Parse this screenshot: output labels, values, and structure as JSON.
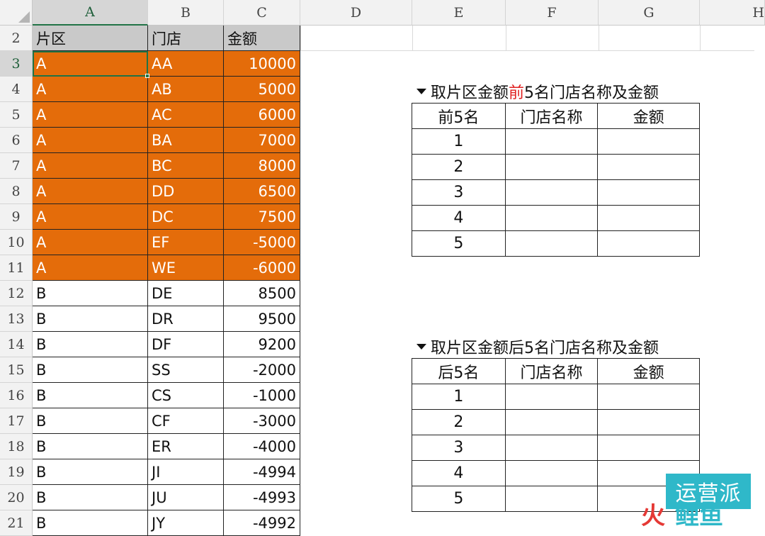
{
  "columns": [
    "A",
    "B",
    "C",
    "D",
    "E",
    "F",
    "G",
    "H"
  ],
  "rows": [
    {
      "num": "2",
      "a": "片区",
      "b": "门店",
      "c": "金额",
      "style": "header"
    },
    {
      "num": "3",
      "a": "A",
      "b": "AA",
      "c": "10000",
      "style": "orange"
    },
    {
      "num": "4",
      "a": "A",
      "b": "AB",
      "c": "5000",
      "style": "orange"
    },
    {
      "num": "5",
      "a": "A",
      "b": "AC",
      "c": "6000",
      "style": "orange"
    },
    {
      "num": "6",
      "a": "A",
      "b": "BA",
      "c": "7000",
      "style": "orange"
    },
    {
      "num": "7",
      "a": "A",
      "b": "BC",
      "c": "8000",
      "style": "orange"
    },
    {
      "num": "8",
      "a": "A",
      "b": "DD",
      "c": "6500",
      "style": "orange"
    },
    {
      "num": "9",
      "a": "A",
      "b": "DC",
      "c": "7500",
      "style": "orange"
    },
    {
      "num": "10",
      "a": "A",
      "b": "EF",
      "c": "-5000",
      "style": "orange"
    },
    {
      "num": "11",
      "a": "A",
      "b": "WE",
      "c": "-6000",
      "style": "orange"
    },
    {
      "num": "12",
      "a": "B",
      "b": "DE",
      "c": "8500",
      "style": "plain"
    },
    {
      "num": "13",
      "a": "B",
      "b": "DR",
      "c": "9500",
      "style": "plain"
    },
    {
      "num": "14",
      "a": "B",
      "b": "DF",
      "c": "9200",
      "style": "plain"
    },
    {
      "num": "15",
      "a": "B",
      "b": "SS",
      "c": "-2000",
      "style": "plain"
    },
    {
      "num": "16",
      "a": "B",
      "b": "CS",
      "c": "-1000",
      "style": "plain"
    },
    {
      "num": "17",
      "a": "B",
      "b": "CF",
      "c": "-3000",
      "style": "plain"
    },
    {
      "num": "18",
      "a": "B",
      "b": "ER",
      "c": "-4000",
      "style": "plain"
    },
    {
      "num": "19",
      "a": "B",
      "b": "JI",
      "c": "-4994",
      "style": "plain"
    },
    {
      "num": "20",
      "a": "B",
      "b": "JU",
      "c": "-4993",
      "style": "plain"
    },
    {
      "num": "21",
      "a": "B",
      "b": "JY",
      "c": "-4992",
      "style": "plain"
    }
  ],
  "top_table": {
    "caption_pre": "取片区金额",
    "caption_red": "前",
    "caption_post": "5名门店名称及金额",
    "headers": [
      "前5名",
      "门店名称",
      "金额"
    ],
    "ranks": [
      "1",
      "2",
      "3",
      "4",
      "5"
    ]
  },
  "bottom_table": {
    "caption": "取片区金额后5名门店名称及金额",
    "headers": [
      "后5名",
      "门店名称",
      "金额"
    ],
    "ranks": [
      "1",
      "2",
      "3",
      "4",
      "5"
    ]
  },
  "watermark": {
    "line1": "运营派",
    "fire": "火",
    "li": "鲤鱼"
  },
  "colors": {
    "orange": "#e46c0a",
    "header_gray": "#c9c9c9",
    "accent_red": "#e02020",
    "excel_green": "#217346",
    "logo_teal": "#2fb8c9"
  }
}
